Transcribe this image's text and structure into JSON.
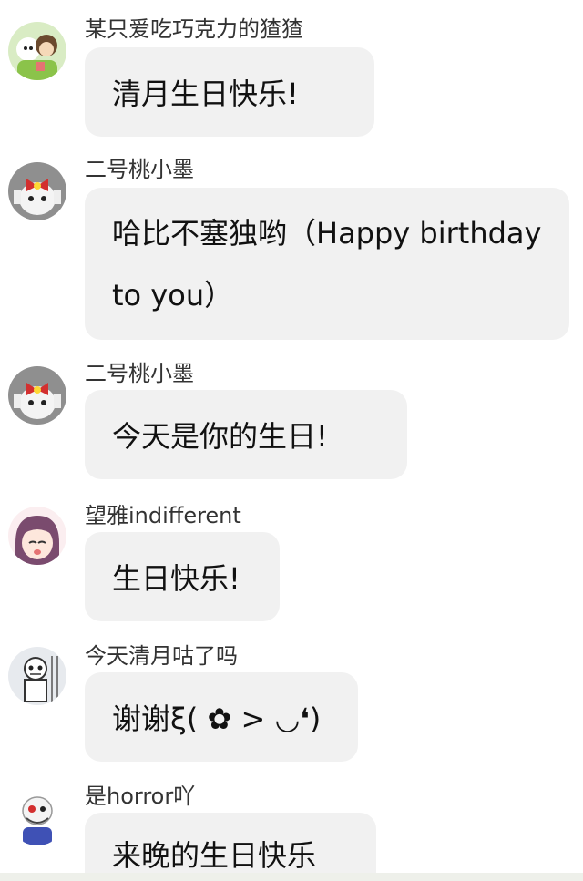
{
  "messages": [
    {
      "user": "某只爱吃巧克力的猹猹",
      "avatar_icon": "anime-couple-avatar-icon",
      "text": "清月生日快乐!"
    },
    {
      "user": "二号桃小墨",
      "avatar_icon": "skull-bow-avatar-icon",
      "text": "哈比不塞独哟（Happy birthday to you）"
    },
    {
      "user": "二号桃小墨",
      "avatar_icon": "skull-bow-avatar-icon",
      "text": "今天是你的生日!"
    },
    {
      "user": "望雅indifferent",
      "avatar_icon": "anime-girl-avatar-icon",
      "text": "生日快乐!"
    },
    {
      "user": "今天清月咕了吗",
      "avatar_icon": "skeleton-sketch-avatar-icon",
      "text": "谢谢ξ( ✿ > ◡❛)"
    },
    {
      "user": "是horror吖",
      "avatar_icon": "horror-skeleton-avatar-icon",
      "text": "来晚的生日快乐"
    }
  ],
  "colors": {
    "bubble_bg": "#f1f1f1",
    "name_text": "#333333",
    "message_text": "#111111"
  }
}
